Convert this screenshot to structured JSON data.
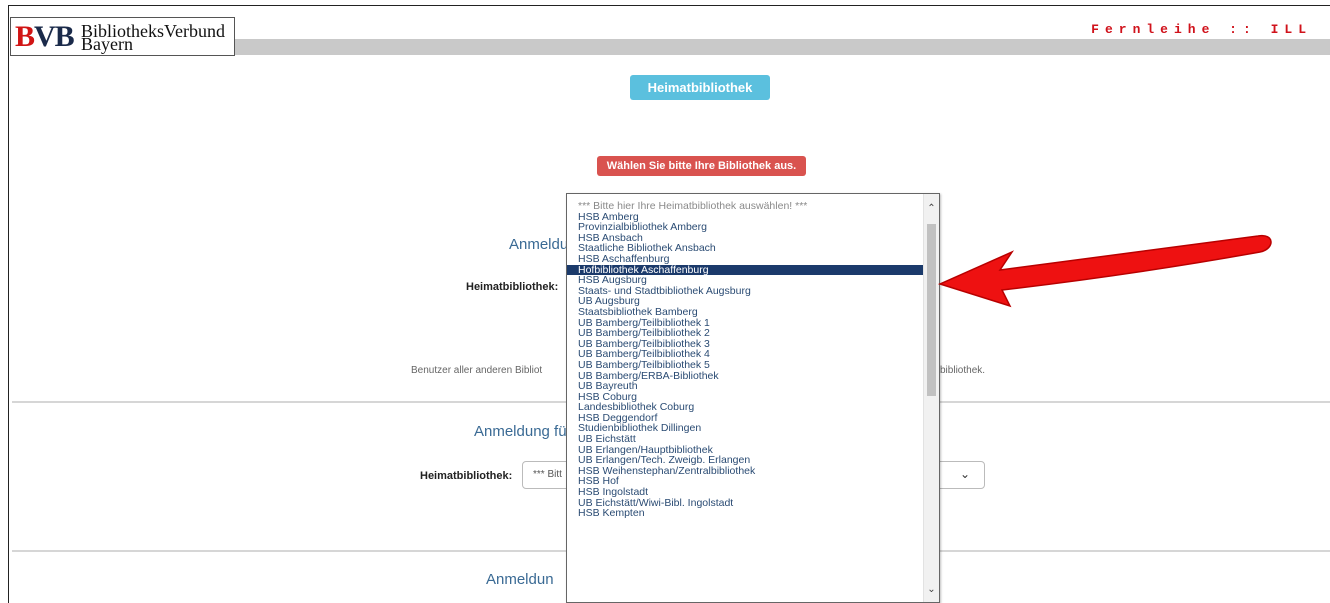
{
  "header": {
    "logo_mark": "BVB",
    "logo_line1": "BibliotheksVerbund",
    "logo_line2": "Bayern",
    "title": "Fernleihe :: ILL"
  },
  "main": {
    "tab_label": "Heimatbibliothek",
    "alert": "Wählen Sie bitte Ihre Bibliothek aus.",
    "section1_heading": "Anmeldu",
    "section1_label": "Heimatbibliothek:",
    "note_left": "Benutzer aller anderen Bibliot",
    "note_right": "bibliothek.",
    "section2_heading": "Anmeldung fü",
    "section2_label": "Heimatbibliothek:",
    "section2_select_value": "*** Bitt",
    "section3_heading": "Anmeldun"
  },
  "dropdown": {
    "options": [
      "*** Bitte hier Ihre Heimatbibliothek auswählen! ***",
      "HSB Amberg",
      "Provinzialbibliothek Amberg",
      "HSB Ansbach",
      "Staatliche Bibliothek Ansbach",
      "HSB Aschaffenburg",
      "Hofbibliothek Aschaffenburg",
      "HSB Augsburg",
      "Staats- und Stadtbibliothek Augsburg",
      "UB Augsburg",
      "Staatsbibliothek Bamberg",
      "UB Bamberg/Teilbibliothek 1",
      "UB Bamberg/Teilbibliothek 2",
      "UB Bamberg/Teilbibliothek 3",
      "UB Bamberg/Teilbibliothek 4",
      "UB Bamberg/Teilbibliothek 5",
      "UB Bamberg/ERBA-Bibliothek",
      "UB Bayreuth",
      "HSB Coburg",
      "Landesbibliothek Coburg",
      "HSB Deggendorf",
      "Studienbibliothek Dillingen",
      "UB Eichstätt",
      "UB Erlangen/Hauptbibliothek",
      "UB Erlangen/Tech. Zweigb. Erlangen",
      "HSB Weihenstephan/Zentralbibliothek",
      "HSB Hof",
      "HSB Ingolstadt",
      "UB Eichstätt/Wiwi-Bibl. Ingolstadt",
      "HSB Kempten"
    ],
    "selected": "Hofbibliothek Aschaffenburg"
  },
  "icons": {
    "scroll_up": "chevron-up-icon",
    "scroll_down": "chevron-down-icon",
    "select_chevron": "chevron-down-icon",
    "annotation": "red-arrow-annotation"
  },
  "colors": {
    "tab": "#5bc0de",
    "alert": "#d9534f",
    "selected_option": "#1b3a6b",
    "brand_red": "#d0121b",
    "arrow": "#ee1111"
  }
}
